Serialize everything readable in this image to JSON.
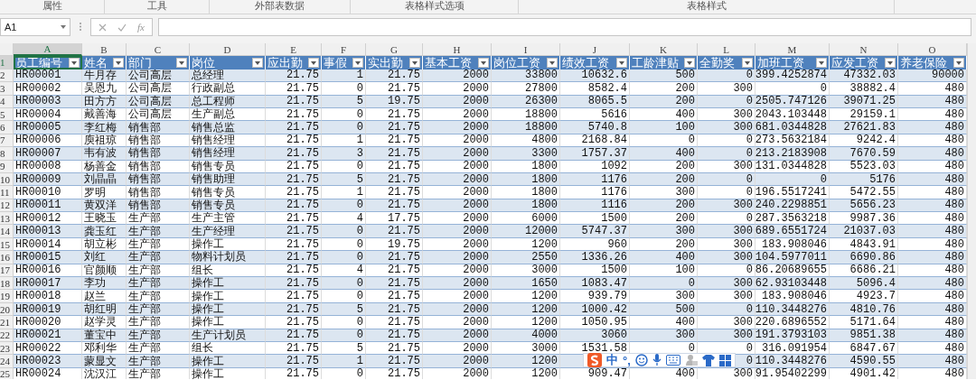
{
  "ribbon": {
    "groups": [
      "属性",
      "工具",
      "外部表数据",
      "表格样式选项",
      "表格样式"
    ]
  },
  "formula_bar": {
    "name_box": "A1",
    "fx": "fx"
  },
  "table": {
    "column_letters": [
      {
        "label": "A",
        "selected": true
      },
      {
        "label": "B",
        "selected": false
      },
      {
        "label": "C",
        "selected": false
      },
      {
        "label": "D",
        "selected": false
      },
      {
        "label": "E",
        "selected": false
      },
      {
        "label": "F",
        "selected": false
      },
      {
        "label": "G",
        "selected": false
      },
      {
        "label": "H",
        "selected": false
      },
      {
        "label": "I",
        "selected": false
      },
      {
        "label": "J",
        "selected": false
      },
      {
        "label": "K",
        "selected": false
      },
      {
        "label": "L",
        "selected": false
      },
      {
        "label": "M",
        "selected": false
      },
      {
        "label": "N",
        "selected": false
      },
      {
        "label": "O",
        "selected": false
      }
    ],
    "header_row": {
      "number": "1",
      "selected": true
    },
    "columns": [
      {
        "header": "员工编号",
        "kind": "text"
      },
      {
        "header": "姓名",
        "kind": "text"
      },
      {
        "header": "部门",
        "kind": "text"
      },
      {
        "header": "岗位",
        "kind": "text"
      },
      {
        "header": "应出勤",
        "kind": "number"
      },
      {
        "header": "事假",
        "kind": "number"
      },
      {
        "header": "实出勤",
        "kind": "number"
      },
      {
        "header": "基本工资",
        "kind": "number"
      },
      {
        "header": "岗位工资",
        "kind": "number"
      },
      {
        "header": "绩效工资",
        "kind": "number"
      },
      {
        "header": "工龄津贴",
        "kind": "number"
      },
      {
        "header": "全勤奖",
        "kind": "number"
      },
      {
        "header": "加班工资",
        "kind": "number"
      },
      {
        "header": "应发工资",
        "kind": "number"
      },
      {
        "header": "养老保险",
        "kind": "number"
      }
    ],
    "rows": [
      {
        "number": "2",
        "selected": false,
        "cells": [
          "HR00001",
          "牛月存",
          "公司高层",
          "总经理",
          "21.75",
          "1",
          "21.75",
          "2000",
          "33800",
          "10632.6",
          "500",
          "0",
          "399.4252874",
          "47332.03",
          "90000"
        ]
      },
      {
        "number": "3",
        "selected": false,
        "cells": [
          "HR00002",
          "吴恩九",
          "公司高层",
          "行政副总",
          "21.75",
          "0",
          "21.75",
          "2000",
          "27800",
          "8582.4",
          "200",
          "300",
          "0",
          "38882.4",
          "480"
        ]
      },
      {
        "number": "4",
        "selected": false,
        "cells": [
          "HR00003",
          "田方方",
          "公司高层",
          "总工程师",
          "21.75",
          "5",
          "19.75",
          "2000",
          "26300",
          "8065.5",
          "200",
          "0",
          "2505.747126",
          "39071.25",
          "480"
        ]
      },
      {
        "number": "5",
        "selected": false,
        "cells": [
          "HR00004",
          "戴善海",
          "公司高层",
          "生产副总",
          "21.75",
          "0",
          "21.75",
          "2000",
          "18800",
          "5616",
          "400",
          "300",
          "2043.103448",
          "29159.1",
          "480"
        ]
      },
      {
        "number": "6",
        "selected": false,
        "cells": [
          "HR00005",
          "李红梅",
          "销售部",
          "销售总监",
          "21.75",
          "0",
          "21.75",
          "2000",
          "18800",
          "5740.8",
          "100",
          "300",
          "681.0344828",
          "27621.83",
          "480"
        ]
      },
      {
        "number": "7",
        "selected": false,
        "cells": [
          "HR00006",
          "庾祖琼",
          "销售部",
          "销售经理",
          "21.75",
          "1",
          "21.75",
          "2000",
          "4800",
          "2168.84",
          "0",
          "0",
          "273.5632184",
          "9242.4",
          "480"
        ]
      },
      {
        "number": "8",
        "selected": false,
        "cells": [
          "HR00007",
          "韦有波",
          "销售部",
          "销售经理",
          "21.75",
          "3",
          "21.75",
          "2000",
          "3300",
          "1757.37",
          "400",
          "0",
          "213.2183908",
          "7670.59",
          "480"
        ]
      },
      {
        "number": "9",
        "selected": false,
        "cells": [
          "HR00008",
          "杨善金",
          "销售部",
          "销售专员",
          "21.75",
          "0",
          "21.75",
          "2000",
          "1800",
          "1092",
          "200",
          "300",
          "131.0344828",
          "5523.03",
          "480"
        ]
      },
      {
        "number": "10",
        "selected": false,
        "cells": [
          "HR00009",
          "刘晶晶",
          "销售部",
          "销售助理",
          "21.75",
          "5",
          "21.75",
          "2000",
          "1800",
          "1176",
          "200",
          "0",
          "0",
          "5176",
          "480"
        ]
      },
      {
        "number": "11",
        "selected": false,
        "cells": [
          "HR00010",
          "罗明",
          "销售部",
          "销售专员",
          "21.75",
          "1",
          "21.75",
          "2000",
          "1800",
          "1176",
          "300",
          "0",
          "196.5517241",
          "5472.55",
          "480"
        ]
      },
      {
        "number": "12",
        "selected": false,
        "cells": [
          "HR00011",
          "黄双洋",
          "销售部",
          "销售专员",
          "21.75",
          "0",
          "21.75",
          "2000",
          "1800",
          "1116",
          "200",
          "300",
          "240.2298851",
          "5656.23",
          "480"
        ]
      },
      {
        "number": "13",
        "selected": false,
        "cells": [
          "HR00012",
          "王晓玉",
          "生产部",
          "生产主管",
          "21.75",
          "4",
          "17.75",
          "2000",
          "6000",
          "1500",
          "200",
          "0",
          "287.3563218",
          "9987.36",
          "480"
        ]
      },
      {
        "number": "14",
        "selected": false,
        "cells": [
          "HR00013",
          "龚玉红",
          "生产部",
          "生产经理",
          "21.75",
          "0",
          "21.75",
          "2000",
          "12000",
          "5747.37",
          "300",
          "300",
          "689.6551724",
          "21037.03",
          "480"
        ]
      },
      {
        "number": "15",
        "selected": false,
        "cells": [
          "HR00014",
          "胡立彬",
          "生产部",
          "操作工",
          "21.75",
          "0",
          "19.75",
          "2000",
          "1200",
          "960",
          "200",
          "300",
          "183.908046",
          "4843.91",
          "480"
        ]
      },
      {
        "number": "16",
        "selected": false,
        "cells": [
          "HR00015",
          "刘红",
          "生产部",
          "物料计划员",
          "21.75",
          "0",
          "21.75",
          "2000",
          "2550",
          "1336.26",
          "400",
          "300",
          "104.5977011",
          "6690.86",
          "480"
        ]
      },
      {
        "number": "17",
        "selected": false,
        "cells": [
          "HR00016",
          "官颜顺",
          "生产部",
          "组长",
          "21.75",
          "4",
          "21.75",
          "2000",
          "3000",
          "1500",
          "100",
          "0",
          "86.20689655",
          "6686.21",
          "480"
        ]
      },
      {
        "number": "18",
        "selected": false,
        "cells": [
          "HR00017",
          "李功",
          "生产部",
          "操作工",
          "21.75",
          "0",
          "21.75",
          "2000",
          "1650",
          "1083.47",
          "0",
          "300",
          "62.93103448",
          "5096.4",
          "480"
        ]
      },
      {
        "number": "19",
        "selected": false,
        "cells": [
          "HR00018",
          "赵兰",
          "生产部",
          "操作工",
          "21.75",
          "0",
          "21.75",
          "2000",
          "1200",
          "939.79",
          "300",
          "300",
          "183.908046",
          "4923.7",
          "480"
        ]
      },
      {
        "number": "20",
        "selected": false,
        "cells": [
          "HR00019",
          "胡红明",
          "生产部",
          "操作工",
          "21.75",
          "5",
          "21.75",
          "2000",
          "1200",
          "1000.42",
          "500",
          "0",
          "110.3448276",
          "4810.76",
          "480"
        ]
      },
      {
        "number": "21",
        "selected": false,
        "cells": [
          "HR00020",
          "赵学灵",
          "生产部",
          "操作工",
          "21.75",
          "0",
          "21.75",
          "2000",
          "1200",
          "1050.95",
          "400",
          "300",
          "220.6896552",
          "5171.64",
          "480"
        ]
      },
      {
        "number": "22",
        "selected": false,
        "cells": [
          "HR00021",
          "董宝中",
          "生产部",
          "生产计划员",
          "21.75",
          "0",
          "21.75",
          "2000",
          "4000",
          "3060",
          "300",
          "300",
          "191.3793103",
          "9851.38",
          "480"
        ]
      },
      {
        "number": "23",
        "selected": false,
        "cells": [
          "HR00022",
          "邓利华",
          "生产部",
          "组长",
          "21.75",
          "5",
          "21.75",
          "2000",
          "3000",
          "1531.58",
          "0",
          "0",
          "316.091954",
          "6847.67",
          "480"
        ]
      },
      {
        "number": "24",
        "selected": false,
        "cells": [
          "HR00023",
          "蒙显文",
          "生产部",
          "操作工",
          "21.75",
          "1",
          "21.75",
          "2000",
          "1200",
          null,
          null,
          "0",
          "110.3448276",
          "4590.55",
          "480"
        ]
      },
      {
        "number": "25",
        "selected": false,
        "cells": [
          "HR00024",
          "沈汉江",
          "生产部",
          "操作工",
          "21.75",
          "0",
          "21.75",
          "2000",
          "1200",
          "909.47",
          "400",
          "300",
          "91.95402299",
          "4901.42",
          "480"
        ]
      }
    ]
  },
  "ime_toolbar": {
    "mode": "中",
    "punctuation": "°,"
  }
}
